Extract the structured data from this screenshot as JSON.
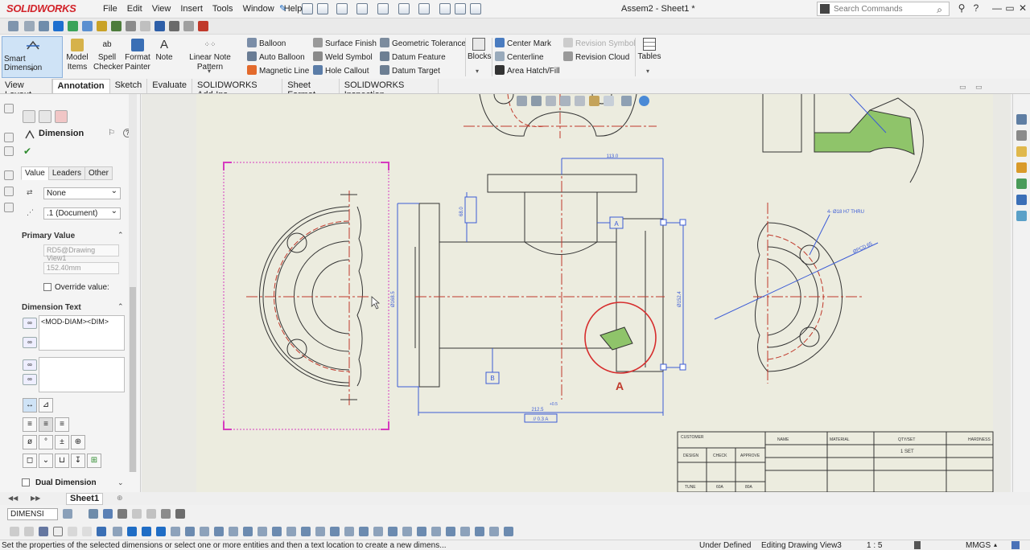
{
  "app": {
    "logo": "SOLIDWORKS",
    "document_title": "Assem2 - Sheet1 *"
  },
  "menu": [
    "File",
    "Edit",
    "View",
    "Insert",
    "Tools",
    "Window",
    "Help"
  ],
  "search": {
    "placeholder": "Search Commands"
  },
  "window_controls": {
    "minimize": "—",
    "restore": "▭",
    "close": "✕",
    "help": "?"
  },
  "command_manager": {
    "smart_dimension": "Smart Dimension",
    "model_items": [
      "Model",
      "Items"
    ],
    "spell_checker": [
      "Spell",
      "Checker"
    ],
    "format_painter": [
      "Format",
      "Painter"
    ],
    "note": "Note",
    "linear_note_pattern": "Linear Note Pattern",
    "col1": [
      "Balloon",
      "Auto Balloon",
      "Magnetic Line"
    ],
    "col2": [
      "Surface Finish",
      "Weld Symbol",
      "Hole Callout"
    ],
    "col3": [
      "Geometric Tolerance",
      "Datum Feature",
      "Datum Target"
    ],
    "blocks": "Blocks",
    "col4": [
      "Center Mark",
      "Centerline",
      "Area Hatch/Fill"
    ],
    "col5": [
      "Revision Symbol",
      "Revision Cloud"
    ],
    "tables": "Tables"
  },
  "tabs": [
    {
      "label": "View Layout"
    },
    {
      "label": "Annotation",
      "active": true
    },
    {
      "label": "Sketch"
    },
    {
      "label": "Evaluate"
    },
    {
      "label": "SOLIDWORKS Add-Ins"
    },
    {
      "label": "Sheet Format"
    },
    {
      "label": "SOLIDWORKS Inspection"
    }
  ],
  "property_manager": {
    "title": "Dimension",
    "ok": "✔",
    "subtabs": [
      "Value",
      "Leaders",
      "Other"
    ],
    "style_select": "None",
    "tolerance_select": ".1 (Document)",
    "primary_value_header": "Primary Value",
    "primary_ref": "RD5@Drawing View1",
    "primary_value": "152.40mm",
    "override_label": "Override value:",
    "dimension_text_header": "Dimension Text",
    "dimension_text": "<MOD-DIAM><DIM>",
    "dual_dimension": "Dual Dimension"
  },
  "drawing": {
    "section_label": "A",
    "dim_top": "113.0",
    "dim_bottom": "212.5",
    "dim_bottom_tol": "+0.5",
    "dim_left": "Ø168.5",
    "dim_right": "Ø152.4",
    "dim_small_left": "68.0",
    "datum_a": "A",
    "datum_b": "B",
    "frame_ref": "// 0.3 A",
    "hole_callout": "4- Ø18 H7 THRU",
    "pcd_callout": "ØPCD 65",
    "tb_headers": [
      "CUSTOMER",
      "NAME",
      "MATERIAL",
      "QTY/SET",
      "HARDNESS"
    ],
    "tb_row": [
      "DESIGN",
      "CHECK",
      "APPROVE"
    ],
    "tb_qty": "1 SET",
    "tb_bottom": [
      "TUNE",
      "60A",
      "80A"
    ]
  },
  "sheet_tab": "Sheet1",
  "layer_select": "DIMENSI",
  "status": {
    "message": "Set the properties of the selected dimensions or select one or more entities and then a text location to create a new dimens...",
    "definition": "Under Defined",
    "editing": "Editing Drawing View3",
    "scale": "1 : 5",
    "units": "MMGS"
  }
}
